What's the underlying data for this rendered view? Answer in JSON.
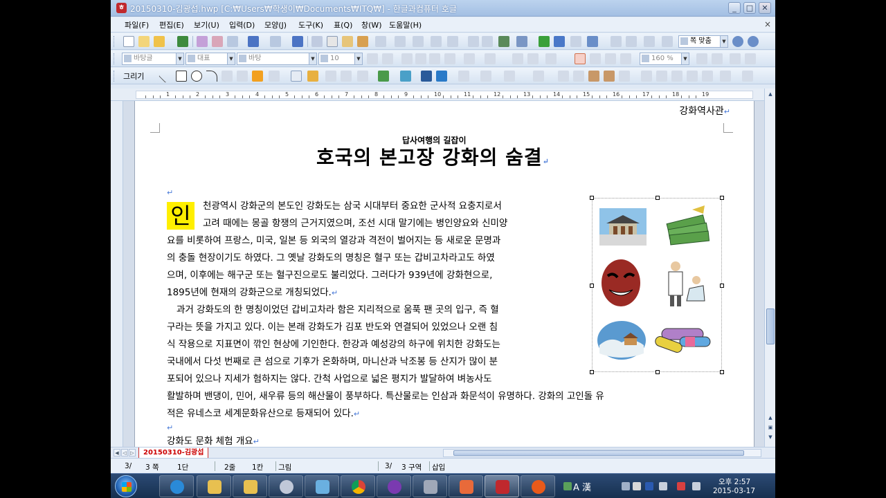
{
  "window": {
    "title": "20150310-김광섭.hwp [C:₩Users₩학생이₩Documents₩ITQ₩] - 한글과컴퓨터 호글",
    "minimize_label": "_",
    "maximize_label": "□",
    "close_label": "✕"
  },
  "menubar": {
    "items": [
      "파일(F)",
      "편집(E)",
      "보기(U)",
      "입력(D)",
      "모양(J)",
      "도구(K)",
      "표(Q)",
      "창(W)",
      "도움말(H)"
    ],
    "close_label": "×"
  },
  "toolbar": {
    "zoom_value": "쪽 맞춤",
    "style_value": "바탕글",
    "lang_value": "대표",
    "font_value": "바탕",
    "size_value": "10",
    "percent_value": "160 %",
    "draw_label": "그리기"
  },
  "ruler": {
    "numbers": [
      "1",
      "2",
      "3",
      "4",
      "5",
      "6",
      "7",
      "8",
      "9",
      "10",
      "11",
      "12",
      "13",
      "14",
      "15",
      "16",
      "17",
      "18",
      "19"
    ]
  },
  "document": {
    "header": "강화역사관",
    "subtitle": "답사여행의 길잡이",
    "title": "호국의 본고장 강화의 숨결",
    "dropcap": "인",
    "lines": [
      "천광역시 강화군의 본도인 강화도는 삼국 시대부터 중요한 군사적 요충지로서",
      "고려 때에는 몽골 항쟁의 근거지였으며, 조선 시대 말기에는 병인양요와 신미양",
      "요를 비롯하여 프랑스, 미국, 일본 등 외국의 열강과 격전이 벌어지는 등 새로운 문명과",
      "의 충돌 현장이기도 하였다. 그 옛날 강화도의 명칭은 혈구 또는 갑비고차라고도 하였",
      "으며, 이후에는 해구군 또는 혈구진으로도 불리었다. 그러다가 939년에 강화현으로,",
      "1895년에 현재의 강화군으로 개칭되었다.",
      "과거 강화도의 한 명칭이었던 갑비고차라 함은 지리적으로 움푹 팬 곳의 입구, 즉 혈",
      "구라는 뜻을 가지고 있다. 이는 본래 강화도가 김포 반도와 연결되어 있었으나 오랜 침",
      "식 작용으로 지표면이 깎인 현상에 기인한다. 한강과 예성강의 하구에 위치한 강화도는",
      "국내에서 다섯 번째로 큰 섬으로 기후가 온화하며, 마니산과 낙조봉 등 산지가 많이 분",
      "포되어 있으나 지세가 험하지는 않다. 간척 사업으로 넓은 평지가 발달하여 벼농사도",
      "활발하며 밴댕이, 민어, 새우류 등의 해산물이 풍부하다. 특산물로는 인삼과 화문석이 유명하다. 강화의 고인돌 유",
      "적은 유네스코 세계문화유산으로 등재되어 있다.",
      "강화도 문화 체험 개요"
    ],
    "para_mark": "↵"
  },
  "doc_tab": "20150310-김광섭",
  "status": {
    "page": "3/",
    "page_count": "3 쪽",
    "column": "1단",
    "line": "2줄",
    "col": "1칸",
    "object": "그림",
    "section": "3/",
    "section_count": "3 구역",
    "mode": "삽입"
  },
  "taskbar": {
    "ime": "A 漢",
    "time": "오후 2:57",
    "date": "2015-03-17"
  },
  "colors": {
    "dropcap_bg": "#ffef00",
    "para_mark": "#4a7bd8",
    "doc_tab_text": "#cc0000"
  }
}
